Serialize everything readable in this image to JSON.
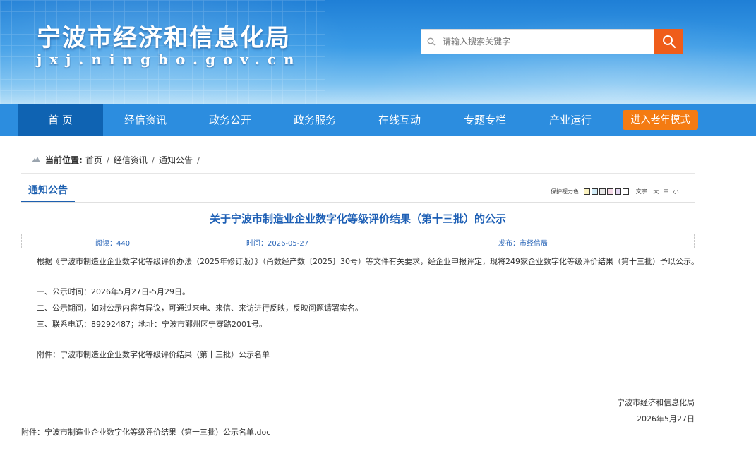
{
  "header": {
    "site_title": "宁波市经济和信息化局",
    "site_domain": "jxj.ningbo.gov.cn",
    "search_placeholder": "请输入搜索关键字"
  },
  "nav": {
    "items": [
      "首 页",
      "经信资讯",
      "政务公开",
      "政务服务",
      "在线互动",
      "专题专栏",
      "产业运行"
    ],
    "elder_mode": "进入老年模式"
  },
  "breadcrumb": {
    "label": "当前位置:",
    "items": [
      "首页",
      "经信资讯",
      "通知公告"
    ],
    "separator": "/"
  },
  "section": {
    "title": "通知公告"
  },
  "tools": {
    "eye_label": "保护视力色:",
    "swatch_colors": [
      "#fbf3c0",
      "#d2ecf7",
      "#e7e7e7",
      "#f5d9e8",
      "#e6d8f3",
      "#ffffff"
    ],
    "font_label": "文字:",
    "sizes": [
      "大",
      "中",
      "小"
    ]
  },
  "article": {
    "title": "关于宁波市制造业企业数字化等级评价结果（第十三批）的公示",
    "reads": "阅读：440",
    "time": "时间：2026-05-27",
    "publisher": "发布：市经信局",
    "para1": "根据《宁波市制造业企业数字化等级评价办法（2025年修订版）》（甬数经产数〔2025〕30号）等文件有关要求，经企业申报评定，现将249家企业数字化等级评价结果（第十三批）予以公示。",
    "item1": "一、公示时间：2026年5月27日-5月29日。",
    "item2": "二、公示期间，如对公示内容有异议，可通过来电、来信、来访进行反映，反映问题请署实名。",
    "item3": "三、联系电话：89292487；地址：宁波市鄞州区宁穿路2001号。",
    "attachment_note": "附件：宁波市制造业企业数字化等级评价结果（第十三批）公示名单",
    "sign_org": "宁波市经济和信息化局",
    "sign_date": "2026年5月27日",
    "attachment_file": "附件：宁波市制造业企业数字化等级评价结果（第十三批）公示名单.doc"
  },
  "colors": {
    "nav": "#2c8ddf",
    "nav_active": "#0f63b2",
    "search_button": "#ef5d1a",
    "elder_button": "#f47b12",
    "title": "#1d5fb5"
  }
}
